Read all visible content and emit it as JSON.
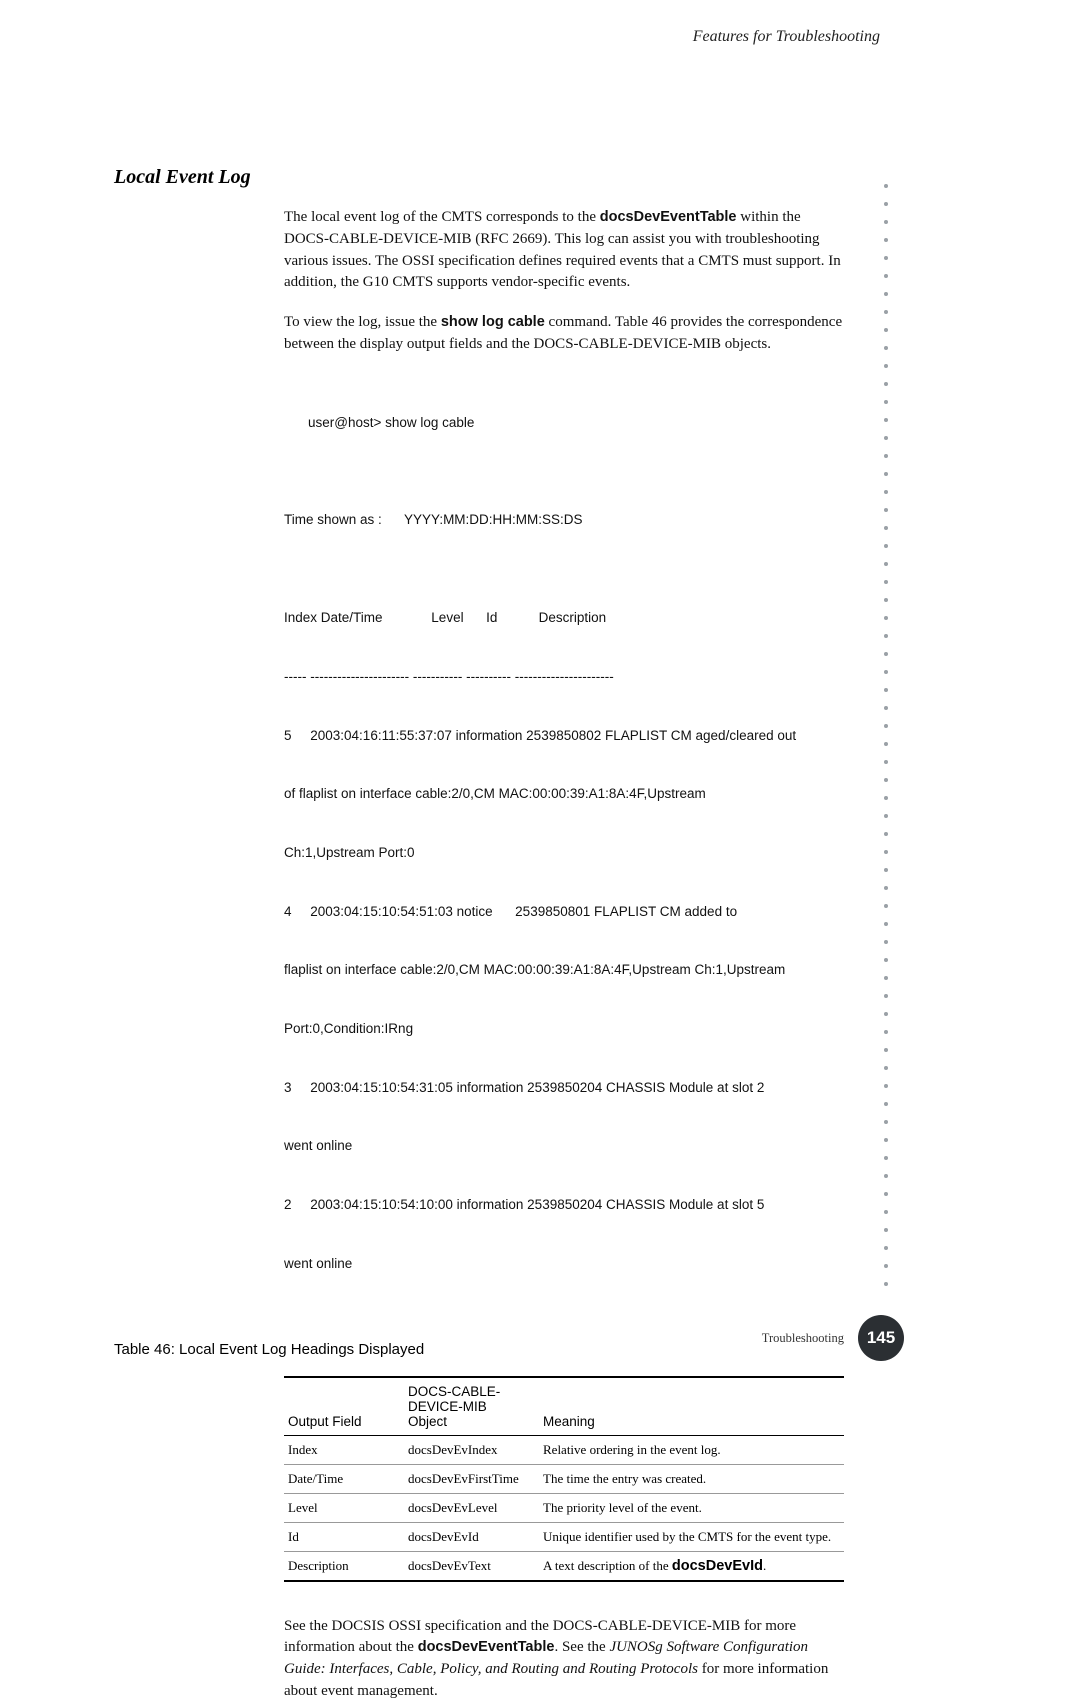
{
  "running_header": "Features for Troubleshooting",
  "section_title": "Local Event Log",
  "para1_a": "The local event log of the CMTS corresponds to the ",
  "para1_b": "docsDevEventTable",
  "para1_c": " within the DOCS-CABLE-DEVICE-MIB (RFC 2669). This log can assist you with troubleshooting various issues. The OSSI specification defines required events that a CMTS must support. In addition, the G10 CMTS supports vendor-specific events.",
  "para2_a": "To view the log, issue the ",
  "para2_b": "show log cable",
  "para2_c": " command. Table 46 provides the correspondence between the display output fields and the DOCS-CABLE-DEVICE-MIB objects.",
  "cli": {
    "prompt": "user@host> show log cable",
    "time_shown": "Time shown as :      YYYY:MM:DD:HH:MM:SS:DS",
    "header": "Index Date/Time             Level      Id           Description",
    "divider": "----- ---------------------- ----------- ---------- ----------------------",
    "rows": [
      "5     2003:04:16:11:55:37:07 information 2539850802 FLAPLIST CM aged/cleared out",
      "of flaplist on interface cable:2/0,CM MAC:00:00:39:A1:8A:4F,Upstream",
      "Ch:1,Upstream Port:0",
      "4     2003:04:15:10:54:51:03 notice      2539850801 FLAPLIST CM added to",
      "flaplist on interface cable:2/0,CM MAC:00:00:39:A1:8A:4F,Upstream Ch:1,Upstream",
      "Port:0,Condition:IRng",
      "3     2003:04:15:10:54:31:05 information 2539850204 CHASSIS Module at slot 2",
      "went online",
      "2     2003:04:15:10:54:10:00 information 2539850204 CHASSIS Module at slot 5",
      "went online"
    ]
  },
  "table_caption": "Table 46:  Local Event Log Headings Displayed",
  "table": {
    "head": {
      "a": "Output Field",
      "b_top": "DOCS-CABLE-DEVICE-MIB",
      "b_bot": "Object",
      "c": "Meaning"
    },
    "rows": [
      {
        "a": "Index",
        "b": "docsDevEvIndex",
        "c": "Relative ordering in the event log."
      },
      {
        "a": "Date/Time",
        "b": "docsDevEvFirstTime",
        "c": "The time the entry was created."
      },
      {
        "a": "Level",
        "b": "docsDevEvLevel",
        "c": "The priority level of the event."
      },
      {
        "a": "Id",
        "b": "docsDevEvId",
        "c": "Unique identifier used by the CMTS for the event type."
      },
      {
        "a": "Description",
        "b": "docsDevEvText",
        "c_pre": "A text description of the ",
        "c_bold": "docsDevEvId",
        "c_post": "."
      }
    ]
  },
  "after_a": "See the DOCSIS OSSI specification and the DOCS-CABLE-DEVICE-MIB for more information about the ",
  "after_b": "docsDevEventTable",
  "after_c": ". See the ",
  "after_d": "JUNOSg Software Configuration Guide: Interfaces, Cable, Policy, and Routing and Routing Protocols",
  "after_e": " for more information about event management.",
  "footer_label": "Troubleshooting",
  "page_number": "145"
}
